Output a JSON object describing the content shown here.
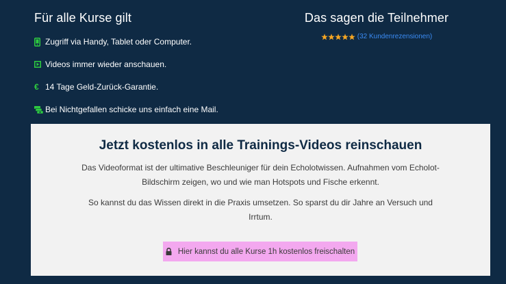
{
  "left_section": {
    "heading": "Für alle Kurse gilt",
    "features": [
      {
        "icon": "mobile-icon",
        "text": "Zugriff via Handy, Tablet oder Computer."
      },
      {
        "icon": "play-icon",
        "text": "Videos immer wieder anschauen."
      },
      {
        "icon": "euro-icon",
        "text": "14 Tage Geld-Zurück-Garantie."
      },
      {
        "icon": "money-icon",
        "text": "Bei Nichtgefallen schicke uns einfach eine Mail."
      }
    ],
    "icon_color": "#2ecc40"
  },
  "right_section": {
    "heading": "Das sagen die Teilnehmer",
    "rating": 5,
    "reviews_link": "(32 Kundenrezensionen)",
    "star_color": "#f5a623"
  },
  "panel": {
    "title": "Jetzt kostenlos in alle Trainings-Videos reinschauen",
    "paragraph1": "Das Videoformat ist der ultimative Beschleuniger für dein Echolotwissen. Aufnahmen vom Echolot-Bildschirm zeigen, wo und wie man Hotspots und Fische erkennt.",
    "paragraph2": "So kannst du das Wissen direkt in die Praxis umsetzen. So sparst du dir Jahre an Versuch und Irrtum.",
    "cta_label": "Hier kannst du alle Kurse 1h kostenlos freischalten",
    "cta_color": "#f3a8ef"
  },
  "colors": {
    "background": "#0f2a44",
    "panel_background": "#f2f2f2",
    "link": "#3b8cf5"
  }
}
